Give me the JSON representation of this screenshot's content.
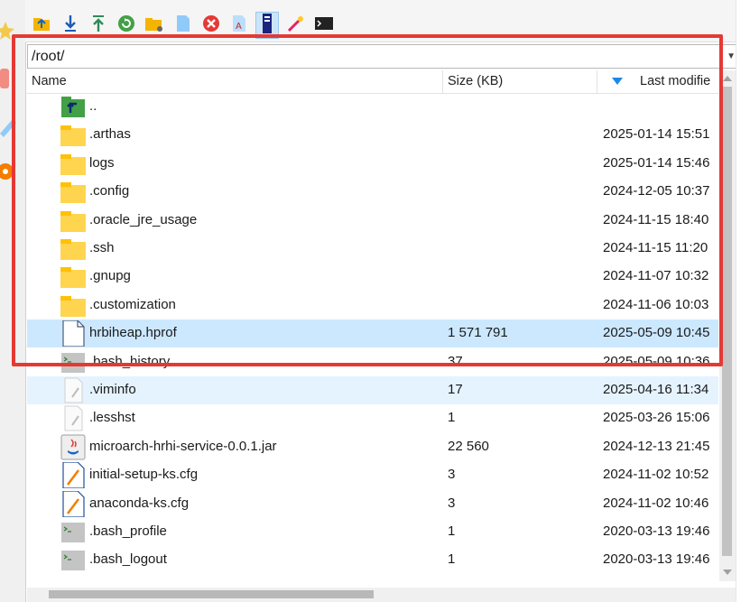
{
  "path": {
    "value": "/root/"
  },
  "columns": {
    "name": "Name",
    "size": "Size (KB)",
    "modified": "Last modifie"
  },
  "toolbar": {
    "items": [
      "parent-folder-icon",
      "download-icon",
      "upload-icon",
      "refresh-icon",
      "new-folder-icon",
      "new-file-icon",
      "delete-icon",
      "rename-icon",
      "properties-icon",
      "magic-wand-icon",
      "terminal-icon"
    ]
  },
  "files": [
    {
      "name": "..",
      "size": "",
      "date": "",
      "icon": "parent-dir-icon"
    },
    {
      "name": ".arthas",
      "size": "",
      "date": "2025-01-14 15:51",
      "icon": "folder-icon"
    },
    {
      "name": "logs",
      "size": "",
      "date": "2025-01-14 15:46",
      "icon": "folder-icon"
    },
    {
      "name": ".config",
      "size": "",
      "date": "2024-12-05 10:37",
      "icon": "folder-icon"
    },
    {
      "name": ".oracle_jre_usage",
      "size": "",
      "date": "2024-11-15 18:40",
      "icon": "folder-icon"
    },
    {
      "name": ".ssh",
      "size": "",
      "date": "2024-11-15 11:20",
      "icon": "folder-icon"
    },
    {
      "name": ".gnupg",
      "size": "",
      "date": "2024-11-07 10:32",
      "icon": "folder-icon"
    },
    {
      "name": ".customization",
      "size": "",
      "date": "2024-11-06 10:03",
      "icon": "folder-icon"
    },
    {
      "name": "hrbiheap.hprof",
      "size": "1 571 791",
      "date": "2025-05-09 10:45",
      "icon": "file-icon"
    },
    {
      "name": ".bash_history",
      "size": "37",
      "date": "2025-05-09 10:36",
      "icon": "shell-file-icon"
    },
    {
      "name": ".viminfo",
      "size": "17",
      "date": "2025-04-16 11:34",
      "icon": "text-file-icon"
    },
    {
      "name": ".lesshst",
      "size": "1",
      "date": "2025-03-26 15:06",
      "icon": "text-file-icon"
    },
    {
      "name": "microarch-hrhi-service-0.0.1.jar",
      "size": "22 560",
      "date": "2024-12-13 21:45",
      "icon": "java-jar-icon"
    },
    {
      "name": "initial-setup-ks.cfg",
      "size": "3",
      "date": "2024-11-02 10:52",
      "icon": "cfg-file-icon"
    },
    {
      "name": "anaconda-ks.cfg",
      "size": "3",
      "date": "2024-11-02 10:46",
      "icon": "cfg-file-icon"
    },
    {
      "name": ".bash_profile",
      "size": "1",
      "date": "2020-03-13 19:46",
      "icon": "shell-file-icon"
    },
    {
      "name": ".bash_logout",
      "size": "1",
      "date": "2020-03-13 19:46",
      "icon": "shell-file-icon"
    }
  ],
  "colors": {
    "selection": "#cce8ff",
    "annotation": "#e53935",
    "folder": "#ffd54f"
  }
}
